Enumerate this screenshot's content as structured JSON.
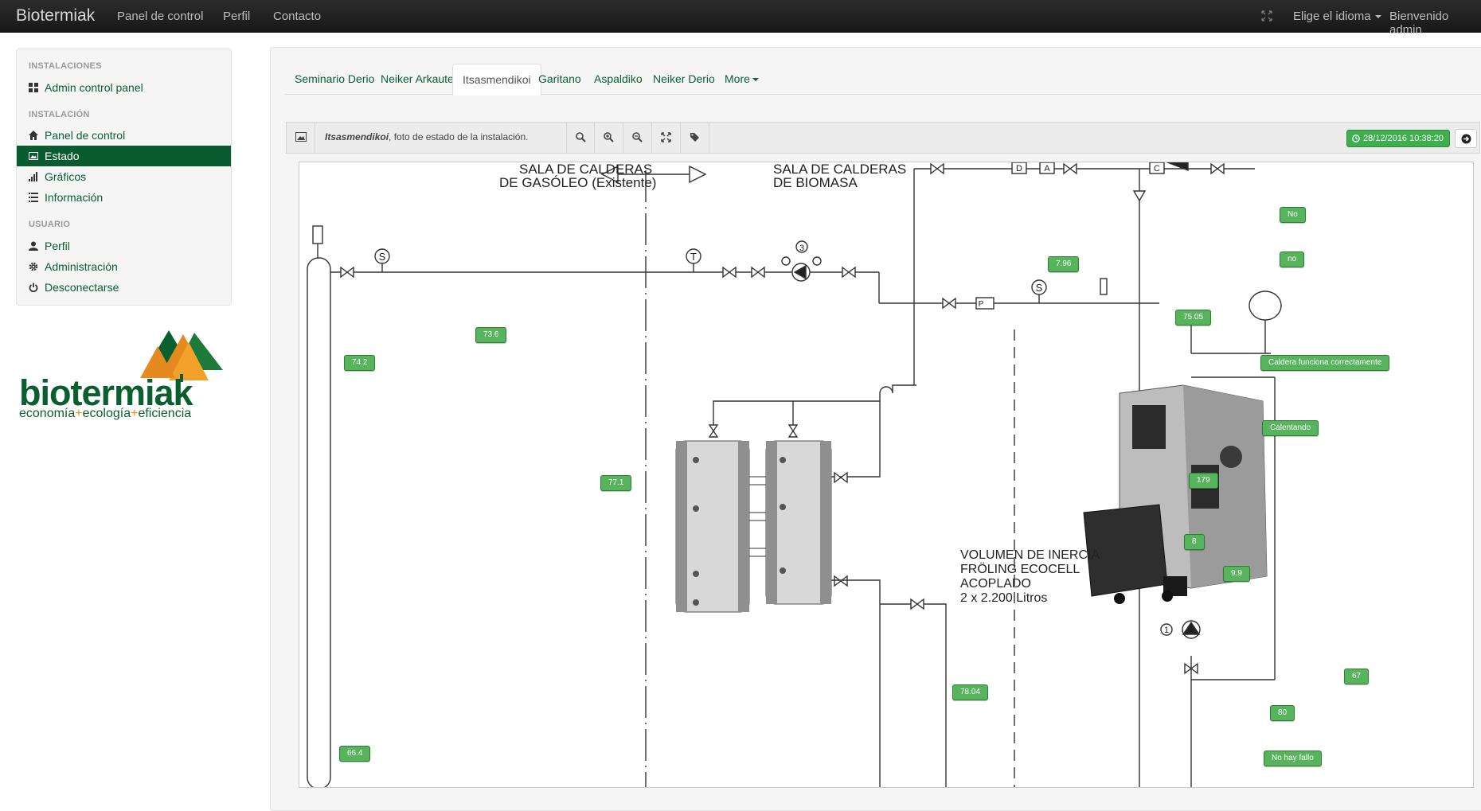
{
  "navbar": {
    "brand": "Biotermiak",
    "links": [
      "Panel de control",
      "Perfil",
      "Contacto"
    ],
    "language": "Elige el idioma",
    "welcome": "Bienvenido admin"
  },
  "sidebar": {
    "sections": [
      {
        "header": "INSTALACIONES",
        "items": [
          {
            "label": "Admin control panel",
            "icon": "th-large-icon"
          }
        ]
      },
      {
        "header": "INSTALACIÓN",
        "items": [
          {
            "label": "Panel de control",
            "icon": "home-icon"
          },
          {
            "label": "Estado",
            "icon": "picture-icon",
            "active": true
          },
          {
            "label": "Gráficos",
            "icon": "signal-icon"
          },
          {
            "label": "Información",
            "icon": "list-icon"
          }
        ]
      },
      {
        "header": "USUARIO",
        "items": [
          {
            "label": "Perfil",
            "icon": "user-icon"
          },
          {
            "label": "Administración",
            "icon": "cog-icon"
          },
          {
            "label": "Desconectarse",
            "icon": "power-icon"
          }
        ]
      }
    ]
  },
  "logo": {
    "word": "biotermiak",
    "tag1": "economía",
    "plus": "+",
    "tag2": "ecología",
    "tag3": "eficiencia"
  },
  "tabs": [
    "Seminario Derio",
    "Neiker Arkaute",
    "Itsasmendikoi",
    "Garitano",
    "Aspaldiko",
    "Neiker Derio",
    "More"
  ],
  "active_tab": "Itsasmendikoi",
  "toolbar": {
    "caption_name": "Itsasmendikoi",
    "caption_rest": ", foto de estado de la instalación.",
    "timestamp": "28/12/2016 10:38:20"
  },
  "diagram": {
    "labels": {
      "sala_gasoleo_1": "SALA DE CALDERAS",
      "sala_gasoleo_2": "DE GASÓLEO (Existente)",
      "sala_biomasa_1": "SALA DE CALDERAS",
      "sala_biomasa_2": "DE BIOMASA",
      "inercia_1": "VOLUMEN DE INERCIA",
      "inercia_2": "FRÖLING ECOCELL",
      "inercia_3": "ACOPLADO",
      "inercia_4": "2 x 2.200 Litros"
    },
    "sensors": {
      "s736": "73.6",
      "s742": "74.2",
      "s771": "77.1",
      "s664": "66.4",
      "s796": "7.96",
      "s7505": "75.05",
      "s7804": "78.04",
      "s179": "179",
      "s8": "8",
      "s99": "9.9",
      "s67": "67",
      "s80": "80",
      "no1": "No",
      "no2": "no",
      "caldera": "Caldera funciona correctamente",
      "calentando": "Calentando",
      "fallo": "No hay fallo"
    },
    "symbols": {
      "s": "S",
      "t": "T",
      "three": "3",
      "one": "1",
      "p": "P",
      "d": "D",
      "a": "A",
      "c": "C"
    }
  },
  "colors": {
    "brand_green": "#0a5c30",
    "sensor_green": "#57b35c",
    "navbar": "#1b1b1b",
    "logo_orange": "#e58a1f"
  }
}
